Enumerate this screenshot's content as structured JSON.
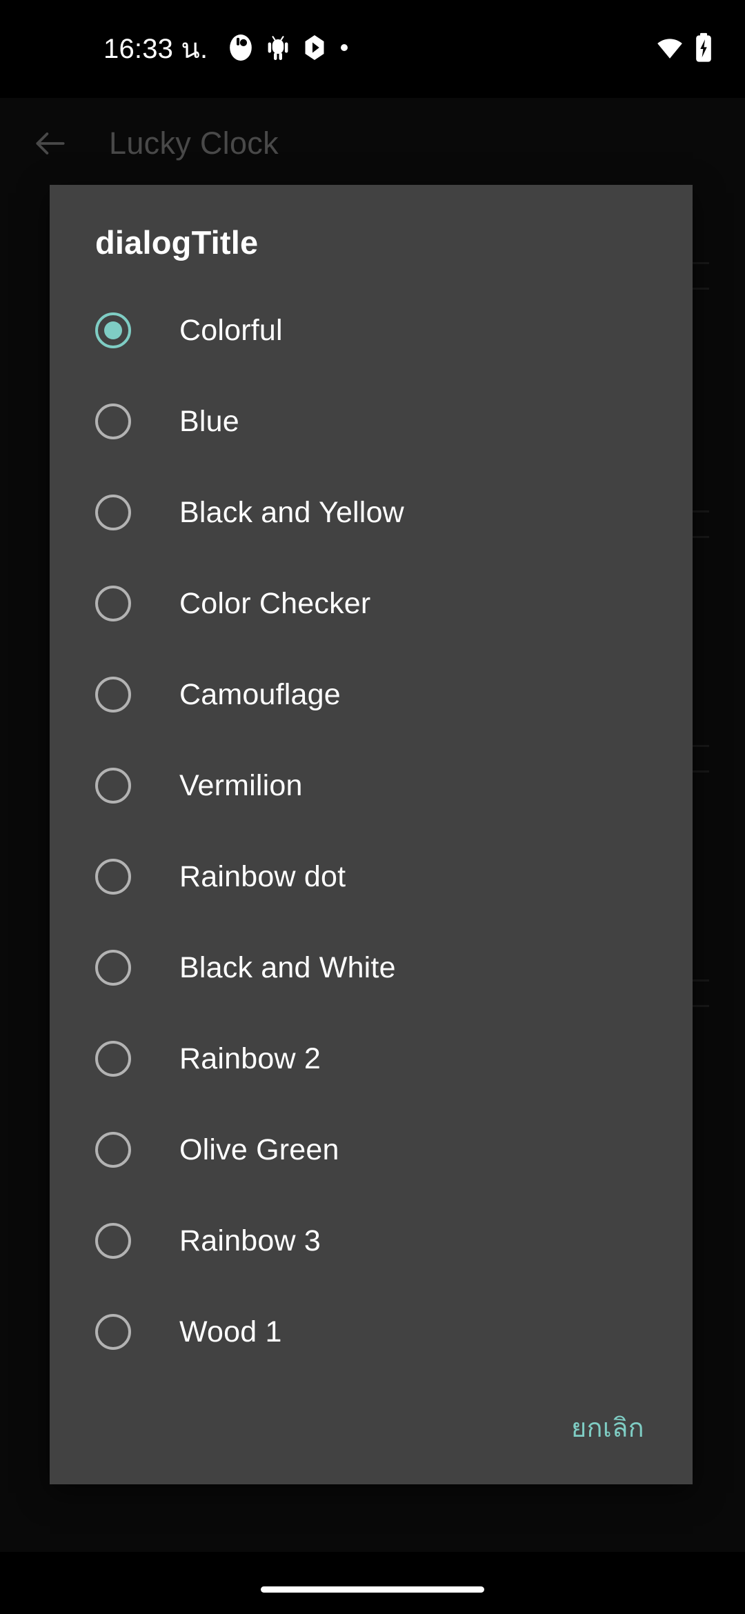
{
  "status_bar": {
    "clock": "16:33 น.",
    "left_icons": [
      "notification-app-icon",
      "android-robot-icon",
      "play-store-icon",
      "dot-icon"
    ],
    "right_icons": [
      "wifi-icon",
      "battery-charging-icon"
    ]
  },
  "app_bar": {
    "back_label": "back-arrow",
    "title": "Lucky Clock"
  },
  "dialog": {
    "title": "dialogTitle",
    "selected_index": 0,
    "options": [
      {
        "label": "Colorful",
        "selected": true
      },
      {
        "label": "Blue",
        "selected": false
      },
      {
        "label": "Black and Yellow",
        "selected": false
      },
      {
        "label": "Color Checker",
        "selected": false
      },
      {
        "label": "Camouflage",
        "selected": false
      },
      {
        "label": "Vermilion",
        "selected": false
      },
      {
        "label": "Rainbow dot",
        "selected": false
      },
      {
        "label": "Black and White",
        "selected": false
      },
      {
        "label": "Rainbow 2",
        "selected": false
      },
      {
        "label": "Olive Green",
        "selected": false
      },
      {
        "label": "Rainbow 3",
        "selected": false
      },
      {
        "label": "Wood 1",
        "selected": false
      }
    ],
    "cancel_label": "ยกเลิก"
  },
  "colors": {
    "accent": "#7fcdc4",
    "dialog_background": "#424242",
    "screen_background": "#121212",
    "status_bar_background": "#000000",
    "radio_unselected": "#b3b3b3",
    "title_text": "#ffffff",
    "app_bar_title": "#8c8c8c"
  }
}
